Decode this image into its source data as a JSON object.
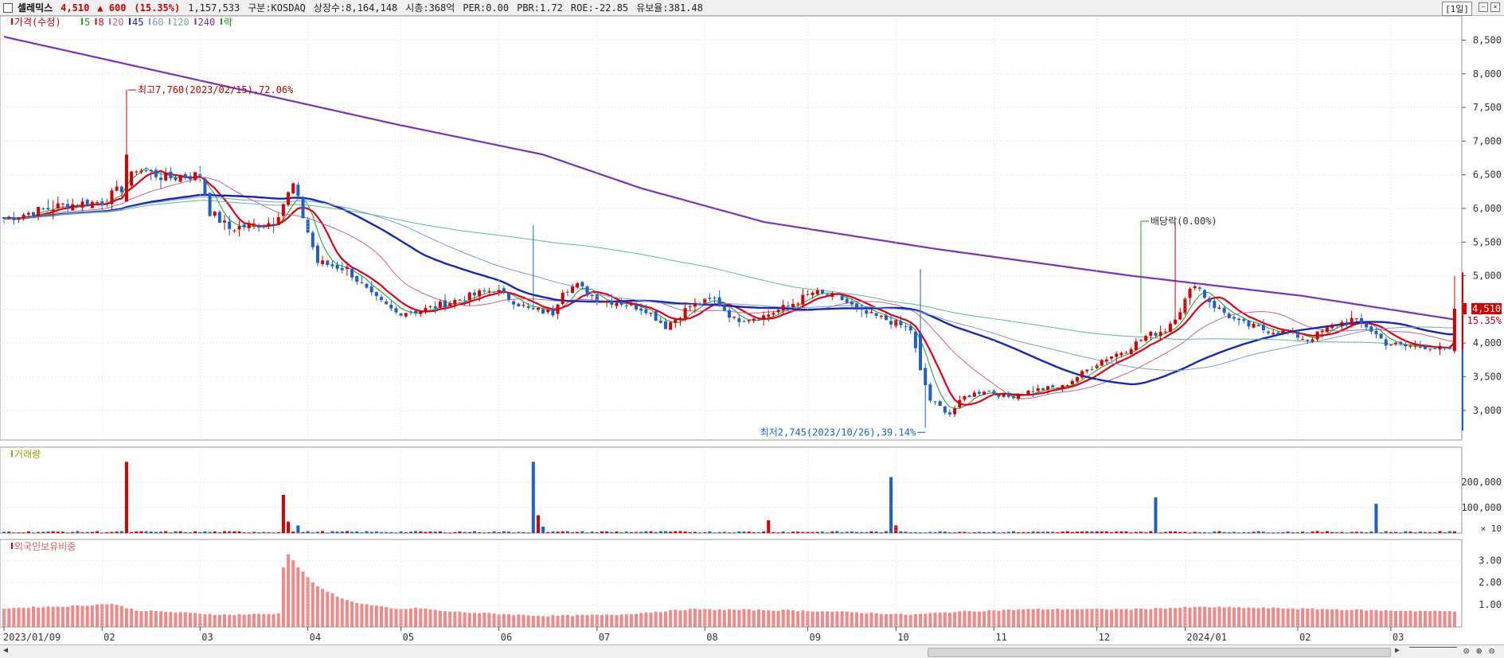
{
  "header": {
    "name": "셀레믹스",
    "price": "4,510",
    "change": "▲ 600",
    "change_pct": "(15.35%)",
    "volume": "1,157,533",
    "market": "구분:KOSDAQ",
    "shares": "상장수:8,164,148",
    "mktcap": "시총:368억",
    "per": "PER:0.00",
    "pbr": "PBR:1.72",
    "roe": "ROE:-22.85",
    "float": "유보율:381.48",
    "period": "[1일]"
  },
  "colors": {
    "up": "#d40000",
    "down": "#1e5fc8",
    "ma5": "#1aa01a",
    "ma8": "#e0001b",
    "ma20": "#c0669a",
    "ma45": "#1428b4",
    "ma60": "#7f9ad8",
    "ma120": "#5fb89a",
    "ma240": "#7a32b8",
    "volume_up": "#d40000",
    "volume_down": "#1e5fc8",
    "foreign": "#f08a8a",
    "grid": "#dcdcdc"
  },
  "chart_data": [
    {
      "type": "candlestick",
      "title": "",
      "legend": [
        {
          "label": "가격(수정)",
          "color": "#d40000"
        },
        {
          "label": "5",
          "color": "#1aa01a"
        },
        {
          "label": "8",
          "color": "#e0001b"
        },
        {
          "label": "20",
          "color": "#c0669a"
        },
        {
          "label": "45",
          "color": "#1428b4"
        },
        {
          "label": "60",
          "color": "#7f9ad8"
        },
        {
          "label": "120",
          "color": "#5fb89a"
        },
        {
          "label": "240",
          "color": "#7a32b8"
        },
        {
          "label": "락",
          "color": "#1aa01a"
        }
      ],
      "y_ticks": [
        3000,
        3500,
        4000,
        4500,
        5000,
        5500,
        6000,
        6500,
        7000,
        7500,
        8000,
        8500
      ],
      "y_tick_labels": [
        "3,000",
        "3,500",
        "4,000",
        "4,500",
        "5,000",
        "5,500",
        "6,000",
        "6,500",
        "7,000",
        "7,500",
        "8,000",
        "8,500"
      ],
      "ylim": [
        2560,
        8860
      ],
      "x_labels": [
        "2023/01/09",
        "02",
        "03",
        "04",
        "05",
        "06",
        "07",
        "08",
        "09",
        "10",
        "11",
        "12",
        "2024/01",
        "02",
        "03"
      ],
      "x_label_days": [
        0,
        20,
        40,
        62,
        81,
        101,
        121,
        143,
        164,
        182,
        202,
        223,
        241,
        264,
        283
      ],
      "total_days": 297,
      "close_anchors": [
        [
          0,
          5850
        ],
        [
          12,
          6050
        ],
        [
          20,
          6100
        ],
        [
          25,
          6350
        ],
        [
          27,
          6600
        ],
        [
          33,
          6450
        ],
        [
          40,
          6500
        ],
        [
          42,
          5950
        ],
        [
          46,
          5700
        ],
        [
          55,
          5800
        ],
        [
          59,
          6350
        ],
        [
          62,
          5650
        ],
        [
          64,
          5200
        ],
        [
          70,
          5100
        ],
        [
          75,
          4700
        ],
        [
          80,
          4450
        ],
        [
          86,
          4500
        ],
        [
          93,
          4650
        ],
        [
          100,
          4800
        ],
        [
          107,
          4500
        ],
        [
          112,
          4450
        ],
        [
          114,
          4800
        ],
        [
          117,
          4850
        ],
        [
          121,
          4650
        ],
        [
          126,
          4600
        ],
        [
          131,
          4500
        ],
        [
          135,
          4250
        ],
        [
          140,
          4550
        ],
        [
          145,
          4650
        ],
        [
          149,
          4350
        ],
        [
          155,
          4400
        ],
        [
          160,
          4550
        ],
        [
          165,
          4750
        ],
        [
          171,
          4650
        ],
        [
          175,
          4450
        ],
        [
          180,
          4350
        ],
        [
          185,
          4200
        ],
        [
          187,
          3600
        ],
        [
          189,
          3150
        ],
        [
          193,
          2950
        ],
        [
          196,
          3200
        ],
        [
          200,
          3300
        ],
        [
          205,
          3200
        ],
        [
          210,
          3300
        ],
        [
          216,
          3350
        ],
        [
          220,
          3550
        ],
        [
          224,
          3750
        ],
        [
          229,
          3900
        ],
        [
          233,
          4100
        ],
        [
          237,
          4200
        ],
        [
          240,
          4500
        ],
        [
          243,
          4900
        ],
        [
          245,
          4700
        ],
        [
          247,
          4550
        ],
        [
          252,
          4300
        ],
        [
          257,
          4200
        ],
        [
          262,
          4150
        ],
        [
          266,
          4050
        ],
        [
          271,
          4250
        ],
        [
          275,
          4350
        ],
        [
          278,
          4250
        ],
        [
          282,
          4000
        ],
        [
          286,
          3950
        ],
        [
          291,
          3950
        ],
        [
          295,
          3880
        ],
        [
          296,
          4510
        ]
      ],
      "ma240_anchors": [
        [
          0,
          8550
        ],
        [
          40,
          7900
        ],
        [
          80,
          7250
        ],
        [
          110,
          6800
        ],
        [
          130,
          6300
        ],
        [
          155,
          5800
        ],
        [
          190,
          5400
        ],
        [
          230,
          5000
        ],
        [
          265,
          4700
        ],
        [
          296,
          4350
        ]
      ],
      "annotations": [
        {
          "label": "최고7,760(2023/02/15),72.06%",
          "day": 25,
          "price": 7760
        },
        {
          "label": "배당락(0.00%)",
          "day": 232,
          "price": 6000
        },
        {
          "label": "최저2,745(2023/10/26),39.14%",
          "day": 188,
          "price": 2745
        }
      ],
      "last_price_label": "4,510",
      "last_pct_label": "15.35%"
    },
    {
      "type": "bar",
      "title": "거래량",
      "y_ticks": [
        100000,
        200000
      ],
      "y_tick_labels": [
        "100,000",
        "200,000"
      ],
      "unit_label": "× 10",
      "ylim": [
        0,
        300000
      ],
      "spikes": [
        [
          25,
          280000
        ],
        [
          57,
          150000
        ],
        [
          58,
          45000
        ],
        [
          60,
          30000
        ],
        [
          108,
          280000
        ],
        [
          109,
          70000
        ],
        [
          110,
          25000
        ],
        [
          156,
          50000
        ],
        [
          181,
          220000
        ],
        [
          182,
          30000
        ],
        [
          235,
          140000
        ],
        [
          280,
          115000
        ]
      ]
    },
    {
      "type": "bar",
      "title": "외국인보유비중",
      "y_ticks": [
        1,
        2,
        3
      ],
      "y_tick_labels": [
        "1.00",
        "2.00",
        "3.00"
      ],
      "ylim": [
        0,
        3.8
      ],
      "anchors": [
        [
          0,
          0.85
        ],
        [
          15,
          0.95
        ],
        [
          22,
          1.05
        ],
        [
          27,
          0.75
        ],
        [
          45,
          0.55
        ],
        [
          56,
          0.6
        ],
        [
          57,
          2.7
        ],
        [
          58,
          3.3
        ],
        [
          60,
          2.7
        ],
        [
          64,
          1.8
        ],
        [
          70,
          1.2
        ],
        [
          73,
          1.05
        ],
        [
          80,
          0.8
        ],
        [
          85,
          0.85
        ],
        [
          90,
          0.7
        ],
        [
          100,
          0.6
        ],
        [
          110,
          0.5
        ],
        [
          125,
          0.55
        ],
        [
          140,
          0.8
        ],
        [
          160,
          0.75
        ],
        [
          175,
          0.65
        ],
        [
          185,
          0.55
        ],
        [
          195,
          0.7
        ],
        [
          210,
          0.8
        ],
        [
          230,
          0.8
        ],
        [
          245,
          0.9
        ],
        [
          260,
          0.85
        ],
        [
          280,
          0.75
        ],
        [
          296,
          0.7
        ]
      ]
    }
  ]
}
